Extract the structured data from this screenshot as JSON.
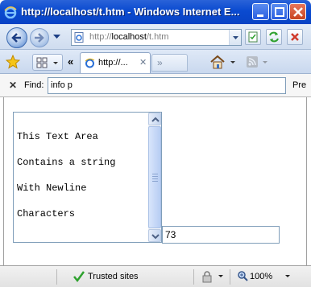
{
  "window": {
    "title": "http://localhost/t.htm - Windows Internet E..."
  },
  "address_bar": {
    "url_prefix": "http://",
    "url_host": "localhost",
    "url_path": "/t.htm"
  },
  "tabs": {
    "active_label": "http://...",
    "new_tab_label": "»",
    "scroll_left_label": "«"
  },
  "find_bar": {
    "label": "Find:",
    "value": "info p",
    "previous_label": "Pre"
  },
  "content": {
    "textarea_lines": [
      "This Text Area",
      "Contains a string",
      "With Newline",
      "Characters"
    ],
    "number_value": "73"
  },
  "status_bar": {
    "zone_label": "Trusted sites",
    "zoom_label": "100%"
  },
  "colors": {
    "titlebar": "#0a4ad0",
    "trusted_check": "#2ea12e"
  }
}
